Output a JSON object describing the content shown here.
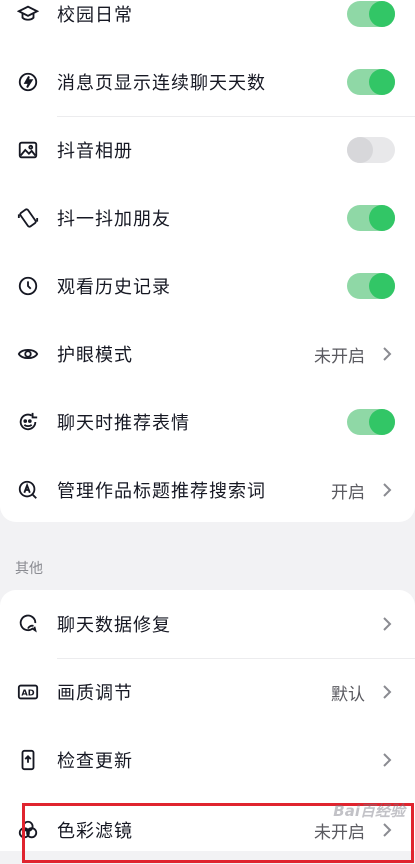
{
  "settings_top": [
    {
      "label": "校园日常",
      "control": "toggle",
      "on": true,
      "icon": "graduation-cap-icon"
    },
    {
      "label": "消息页显示连续聊天天数",
      "control": "toggle",
      "on": true,
      "icon": "flame-icon"
    },
    {
      "label": "抖音相册",
      "control": "toggle",
      "on": false,
      "icon": "image-icon"
    },
    {
      "label": "抖一抖加朋友",
      "control": "toggle",
      "on": true,
      "icon": "shake-phone-icon"
    },
    {
      "label": "观看历史记录",
      "control": "toggle",
      "on": true,
      "icon": "clock-icon"
    },
    {
      "label": "护眼模式",
      "control": "link",
      "value": "未开启",
      "icon": "eye-icon"
    },
    {
      "label": "聊天时推荐表情",
      "control": "toggle",
      "on": true,
      "icon": "emoji-icon"
    },
    {
      "label": "管理作品标题推荐搜索词",
      "control": "link",
      "value": "开启",
      "icon": "search-a-icon"
    }
  ],
  "section_other": {
    "title": "其他",
    "items": [
      {
        "label": "聊天数据修复",
        "control": "link",
        "value": "",
        "icon": "chat-repair-icon"
      },
      {
        "label": "画质调节",
        "control": "link",
        "value": "默认",
        "icon": "ad-badge-icon"
      },
      {
        "label": "检查更新",
        "control": "link",
        "value": "",
        "icon": "phone-update-icon"
      },
      {
        "label": "色彩滤镜",
        "control": "link",
        "value": "未开启",
        "icon": "color-filter-icon"
      }
    ]
  },
  "icons": {
    "ad_badge_text": "AD"
  },
  "colors": {
    "toggle_on": "#32c666",
    "toggle_track_on": "#8fd8a6",
    "toggle_off": "#d7d7da",
    "highlight": "#e0242f"
  },
  "watermark": "Bai百经验"
}
